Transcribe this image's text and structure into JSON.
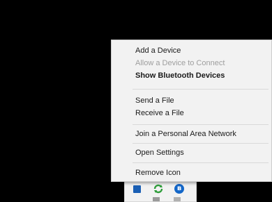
{
  "context_menu": {
    "items": [
      {
        "label": "Add a Device",
        "enabled": true,
        "bold": false
      },
      {
        "label": "Allow a Device to Connect",
        "enabled": false,
        "bold": false
      },
      {
        "label": "Show Bluetooth Devices",
        "enabled": true,
        "bold": true
      },
      {
        "label": "Send a File",
        "enabled": true,
        "bold": false
      },
      {
        "label": "Receive a File",
        "enabled": true,
        "bold": false
      },
      {
        "label": "Join a Personal Area Network",
        "enabled": true,
        "bold": false
      },
      {
        "label": "Open Settings",
        "enabled": true,
        "bold": false
      },
      {
        "label": "Remove Icon",
        "enabled": true,
        "bold": false
      }
    ]
  },
  "tray_flyout": {
    "icons": [
      "app-icon",
      "sync-arrows-icon",
      "bluetooth-icon"
    ],
    "bluetooth_glyph": "ʙ"
  },
  "colors": {
    "desktop_bg": "#000000",
    "menu_bg": "#f2f2f2",
    "disabled_text": "#9e9e9e",
    "bluetooth_blue": "#1467c8"
  }
}
